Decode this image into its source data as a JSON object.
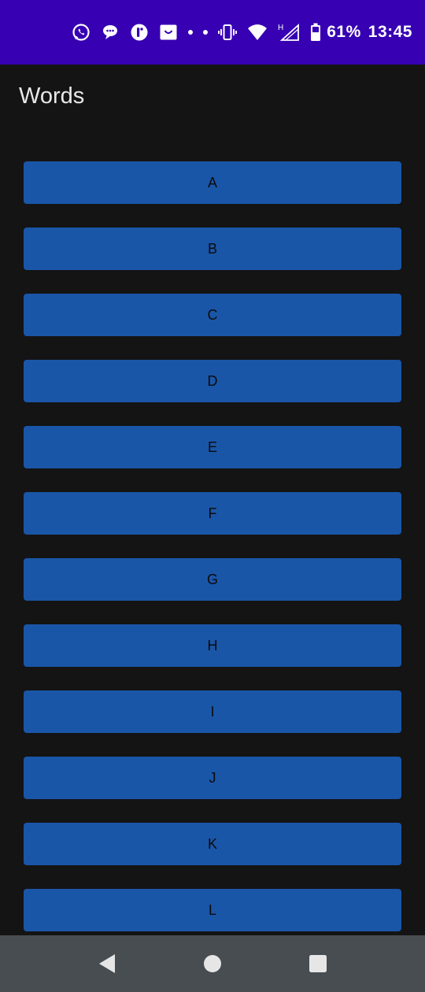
{
  "status_bar": {
    "battery": "61%",
    "time": "13:45",
    "icons": [
      "whatsapp-icon",
      "chat-bubble-icon",
      "app-icon",
      "shopping-bag-icon",
      "dot-icon",
      "dot-icon",
      "vibrate-icon",
      "wifi-icon",
      "signal-h-icon",
      "battery-icon"
    ],
    "background": "#3700b3"
  },
  "app": {
    "title": "Words",
    "background": "#141414",
    "button_color": "#1a56a8"
  },
  "words": [
    "A",
    "B",
    "C",
    "D",
    "E",
    "F",
    "G",
    "H",
    "I",
    "J",
    "K",
    "L"
  ],
  "nav_bar": {
    "icons": [
      "back-icon",
      "home-icon",
      "recents-icon"
    ],
    "background": "#474d51"
  }
}
